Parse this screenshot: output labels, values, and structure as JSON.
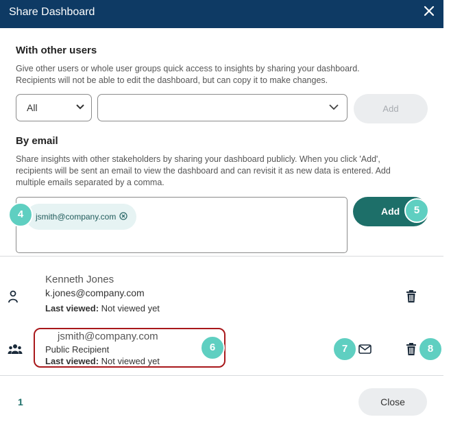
{
  "dialog": {
    "title": "Share Dashboard"
  },
  "other_users": {
    "heading": "With other users",
    "description_line1": "Give other users or whole user groups quick access to insights by sharing your dashboard.",
    "description_line2": "Recipients will not be able to edit the dashboard, but can copy it to make changes.",
    "filter_select_value": "All",
    "user_select_value": "",
    "add_label": "Add"
  },
  "by_email": {
    "heading": "By email",
    "description_line1": "Share insights with other stakeholders by sharing your dashboard publicly. When you click 'Add',",
    "description_line2": "recipients will be sent an email to view the dashboard and can revisit it as new data is entered. Add",
    "description_line3": "multiple emails separated by a comma.",
    "chip_email": "jsmith@company.com",
    "add_label": "Add"
  },
  "recipients": [
    {
      "name": "Kenneth Jones",
      "email": "k.jones@company.com",
      "last_viewed_label": "Last viewed:",
      "last_viewed_value": "Not viewed yet",
      "icon": "person-icon"
    },
    {
      "email": "jsmith@company.com",
      "type": "Public Recipient",
      "last_viewed_label": "Last viewed:",
      "last_viewed_value": "Not viewed yet",
      "icon": "group-icon"
    }
  ],
  "badges": {
    "b4": "4",
    "b5": "5",
    "b6": "6",
    "b7": "7",
    "b8": "8"
  },
  "footer": {
    "page": "1",
    "close_label": "Close"
  },
  "colors": {
    "header": "#0e3a64",
    "accent": "#1d6f69",
    "badge": "#5fcfc1",
    "highlight": "#a8171a"
  }
}
